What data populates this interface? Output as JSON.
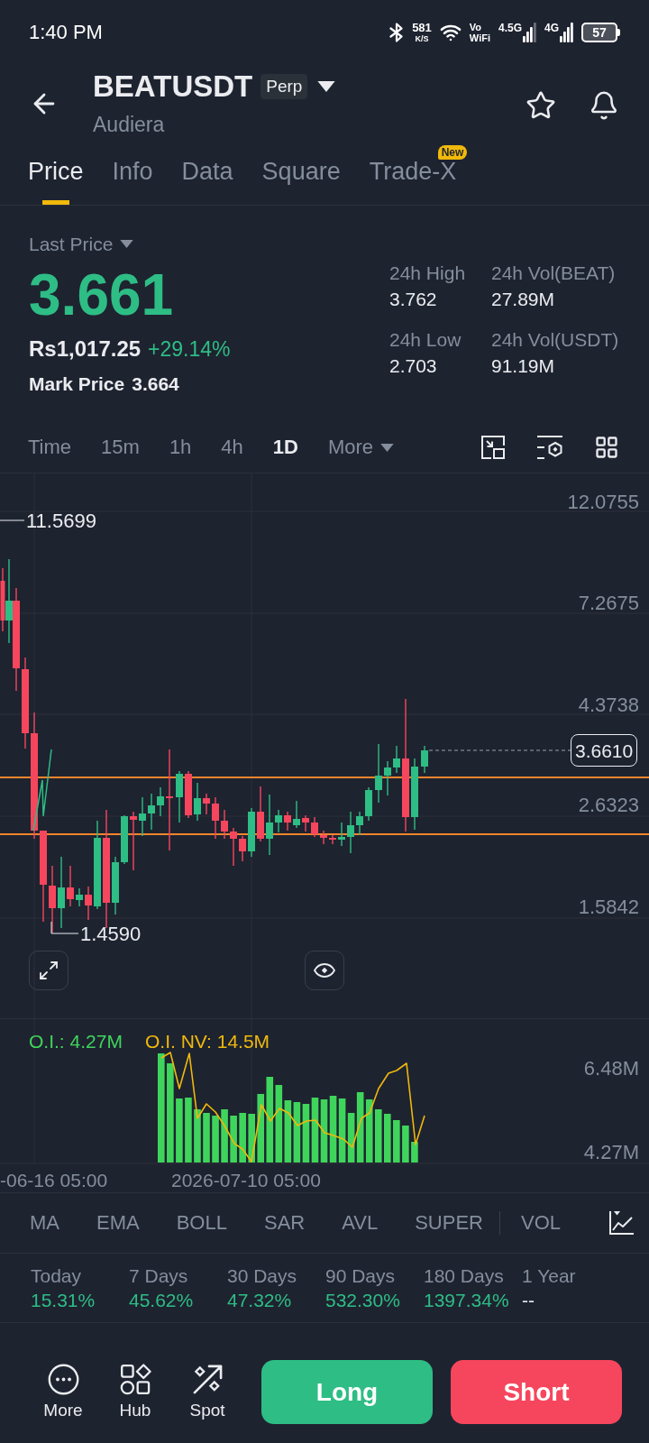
{
  "status_bar": {
    "time": "1:40 PM",
    "net_speed": "581",
    "net_speed_unit": "K/S",
    "vowifi": [
      "Vo",
      "WiFi"
    ],
    "network_primary": "4.5G",
    "network_secondary": "4G",
    "battery": "57"
  },
  "header": {
    "symbol": "BEATUSDT",
    "contract_badge": "Perp",
    "name": "Audiera",
    "favorite": false
  },
  "tabs": [
    {
      "label": "Price",
      "selected": true
    },
    {
      "label": "Info",
      "selected": false
    },
    {
      "label": "Data",
      "selected": false
    },
    {
      "label": "Square",
      "selected": false
    },
    {
      "label": "Trade-X",
      "selected": false,
      "badge": "New"
    }
  ],
  "price": {
    "type_label": "Last Price",
    "last": "3.661",
    "fiat": "Rs1,017.25",
    "change": "+29.14%",
    "mark_label": "Mark Price",
    "mark": "3.664"
  },
  "stats": [
    {
      "label": "24h High",
      "value": "3.762"
    },
    {
      "label": "24h Vol(BEAT)",
      "value": "27.89M"
    },
    {
      "label": "24h Low",
      "value": "2.703"
    },
    {
      "label": "24h Vol(USDT)",
      "value": "91.19M"
    }
  ],
  "intervals": [
    {
      "label": "Time",
      "selected": false,
      "kind": "interval"
    },
    {
      "label": "15m",
      "selected": false,
      "kind": "interval"
    },
    {
      "label": "1h",
      "selected": false,
      "kind": "interval"
    },
    {
      "label": "4h",
      "selected": false,
      "kind": "interval"
    },
    {
      "label": "1D",
      "selected": true,
      "kind": "interval"
    },
    {
      "label": "More",
      "selected": false,
      "kind": "dropdown"
    }
  ],
  "chart": {
    "price_ticks": [
      "12.0755",
      "7.2675",
      "4.3738",
      "2.6323",
      "1.5842"
    ],
    "high_marker": "11.5699",
    "low_marker": "1.4590",
    "current_price": "3.6610"
  },
  "open_interest": {
    "oi_label": "O.I.: 4.27M",
    "nv_label": "O.I. NV: 14.5M",
    "ticks": [
      "6.48M",
      "4.27M"
    ],
    "dates": [
      "-06-16 05:00",
      "2026-07-10 05:00"
    ]
  },
  "indicators": {
    "main": [
      "MA",
      "EMA",
      "BOLL",
      "SAR",
      "AVL",
      "SUPER"
    ],
    "sub": [
      "VOL"
    ]
  },
  "performance": [
    {
      "label": "Today",
      "value": "15.31%",
      "kind": "positive"
    },
    {
      "label": "7 Days",
      "value": "45.62%",
      "kind": "positive"
    },
    {
      "label": "30 Days",
      "value": "47.32%",
      "kind": "positive"
    },
    {
      "label": "90 Days",
      "value": "532.30%",
      "kind": "positive"
    },
    {
      "label": "180 Days",
      "value": "1397.34%",
      "kind": "positive"
    },
    {
      "label": "1 Year",
      "value": "--",
      "kind": "empty"
    }
  ],
  "bottom_nav": [
    {
      "label": "More"
    },
    {
      "label": "Hub"
    },
    {
      "label": "Spot"
    }
  ],
  "actions": [
    {
      "label": "Long",
      "kind": "buy"
    },
    {
      "label": "Short",
      "kind": "sell"
    }
  ]
}
